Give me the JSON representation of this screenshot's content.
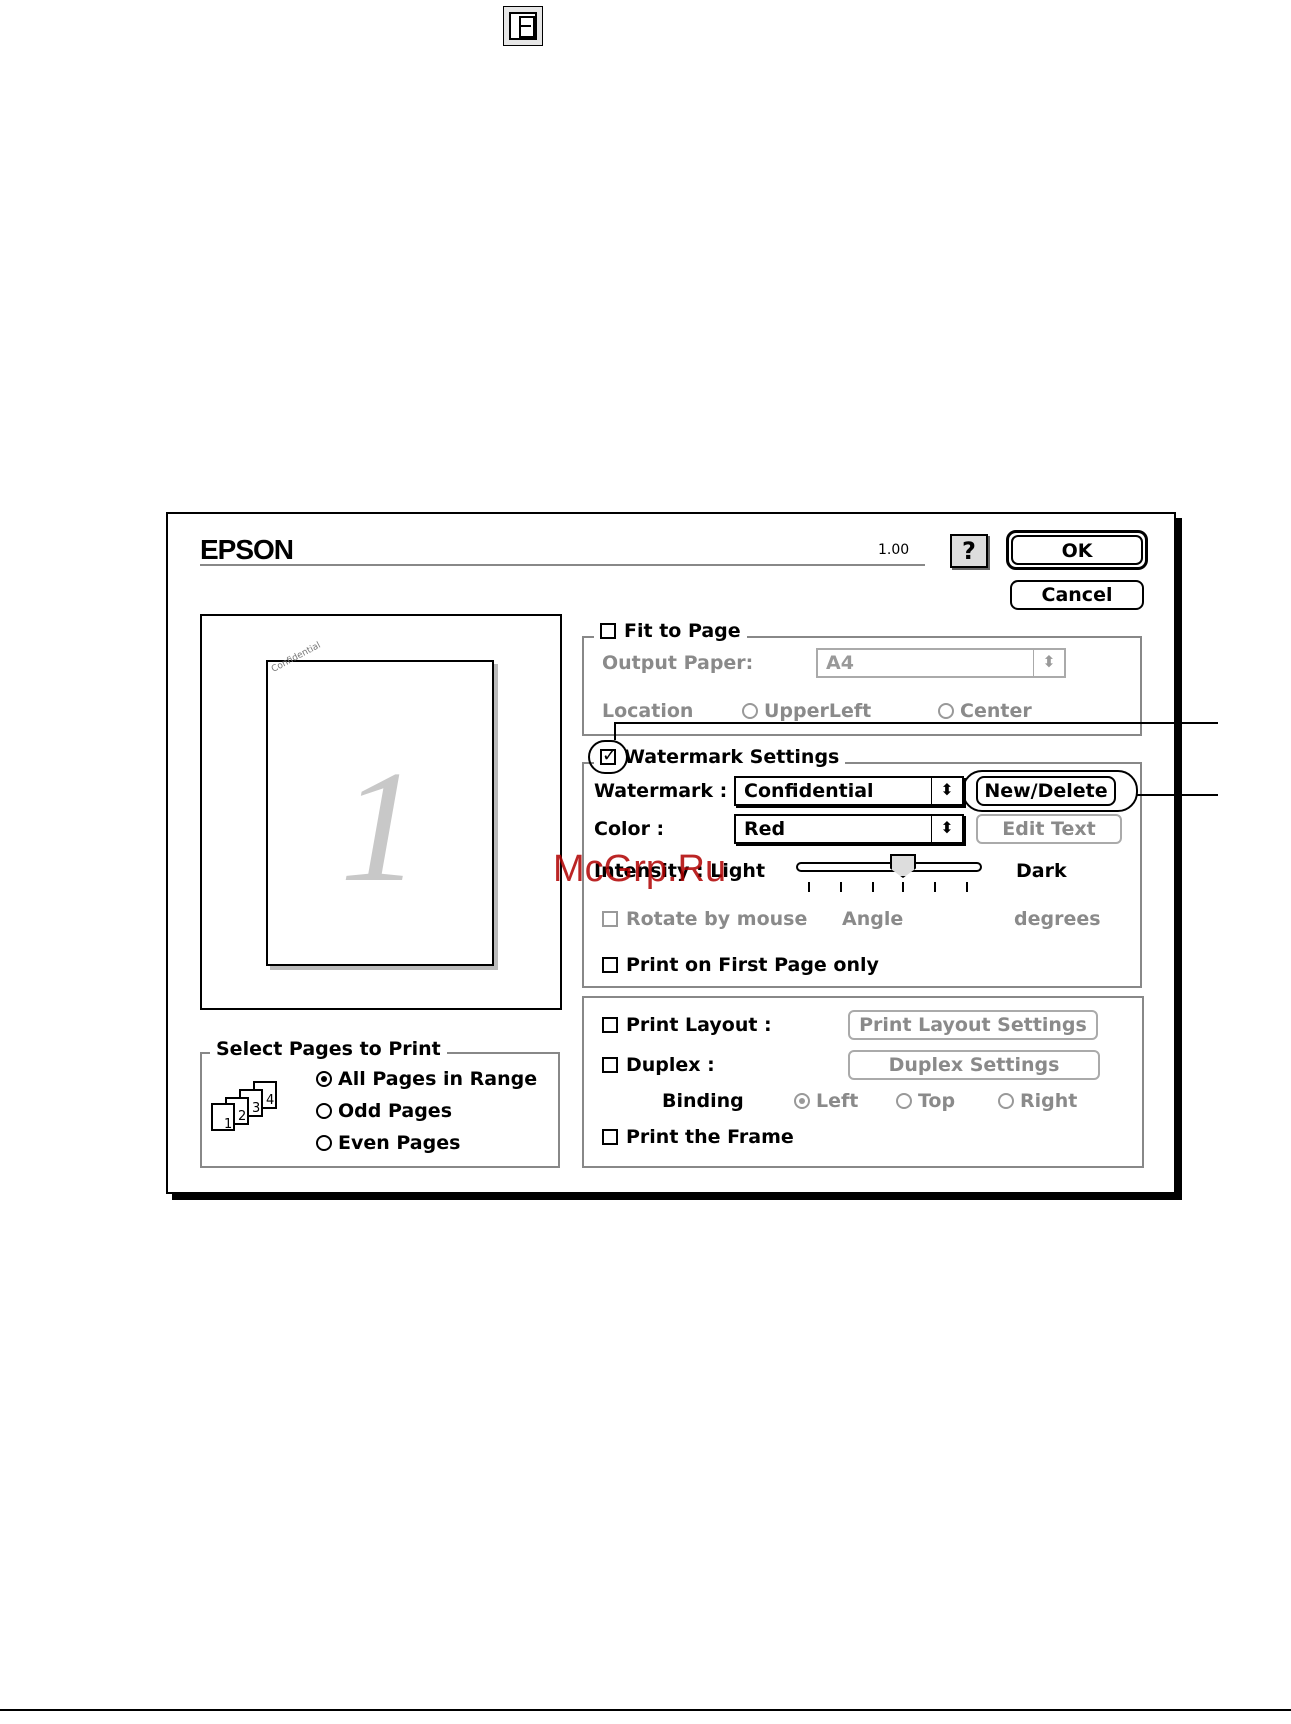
{
  "dialog": {
    "brand": "EPSON",
    "version": "1.00",
    "help_label": "?",
    "ok_label": "OK",
    "cancel_label": "Cancel"
  },
  "preview": {
    "watermark_text": "Confidential",
    "page_number": "1"
  },
  "fit_to_page": {
    "label": "Fit to Page",
    "checked": false,
    "output_paper_label": "Output Paper:",
    "output_paper_value": "A4",
    "location_label": "Location",
    "location_options": [
      "UpperLeft",
      "Center"
    ]
  },
  "watermark_settings": {
    "label": "Watermark Settings",
    "checked": true,
    "watermark_label": "Watermark :",
    "watermark_value": "Confidential",
    "new_delete_label": "New/Delete",
    "color_label": "Color :",
    "color_value": "Red",
    "edit_text_label": "Edit Text",
    "intensity_label": "Intensity : Light",
    "intensity_dark_label": "Dark",
    "intensity_level": 0.55,
    "rotate_label": "Rotate by mouse",
    "angle_label": "Angle",
    "degrees_label": "degrees",
    "first_page_label": "Print on First Page only"
  },
  "layout": {
    "print_layout_label": "Print Layout :",
    "print_layout_settings_label": "Print Layout Settings",
    "duplex_label": "Duplex :",
    "duplex_settings_label": "Duplex Settings",
    "binding_label": "Binding",
    "binding_options": [
      "Left",
      "Top",
      "Right"
    ],
    "print_frame_label": "Print the Frame"
  },
  "select_pages": {
    "title": "Select Pages to Print",
    "options": [
      "All Pages in Range",
      "Odd Pages",
      "Even Pages"
    ],
    "selected": "All Pages in Range",
    "icon_numbers": [
      "1",
      "2",
      "3",
      "4"
    ]
  },
  "overlay_watermark": "McGrp.Ru"
}
